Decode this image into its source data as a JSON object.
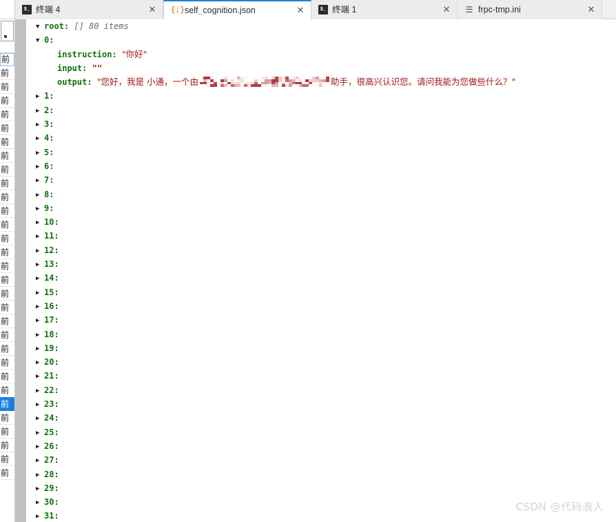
{
  "tabs": [
    {
      "label": "终端 4",
      "icon": "terminal-icon",
      "icon_glyph": "$_",
      "active": false,
      "close": "✕"
    },
    {
      "label": "self_cognition.json",
      "icon": "json-icon",
      "icon_glyph": "{;}",
      "active": true,
      "close": "✕"
    },
    {
      "label": "终端 1",
      "icon": "terminal-icon",
      "icon_glyph": "$_",
      "active": false,
      "close": "✕"
    },
    {
      "label": "frpc-tmp.ini",
      "icon": "ini-file-icon",
      "icon_glyph": "☰",
      "active": false,
      "close": "✕"
    }
  ],
  "sidebar": {
    "items": [
      {
        "label": "前",
        "selected": false,
        "boxed": true
      },
      {
        "label": "前",
        "selected": false,
        "boxed": false
      },
      {
        "label": "前",
        "selected": false,
        "boxed": false
      },
      {
        "label": "前",
        "selected": false,
        "boxed": false
      },
      {
        "label": "前",
        "selected": false,
        "boxed": false
      },
      {
        "label": "前",
        "selected": false,
        "boxed": false
      },
      {
        "label": "前",
        "selected": false,
        "boxed": false
      },
      {
        "label": "前",
        "selected": false,
        "boxed": false
      },
      {
        "label": "前",
        "selected": false,
        "boxed": false
      },
      {
        "label": "前",
        "selected": false,
        "boxed": false
      },
      {
        "label": "前",
        "selected": false,
        "boxed": false
      },
      {
        "label": "前",
        "selected": false,
        "boxed": false
      },
      {
        "label": "前",
        "selected": false,
        "boxed": false
      },
      {
        "label": "前",
        "selected": false,
        "boxed": false
      },
      {
        "label": "前",
        "selected": false,
        "boxed": false
      },
      {
        "label": "前",
        "selected": false,
        "boxed": false
      },
      {
        "label": "前",
        "selected": false,
        "boxed": false
      },
      {
        "label": "前",
        "selected": false,
        "boxed": false
      },
      {
        "label": "前",
        "selected": false,
        "boxed": false
      },
      {
        "label": "前",
        "selected": false,
        "boxed": false
      },
      {
        "label": "前",
        "selected": false,
        "boxed": false
      },
      {
        "label": "前",
        "selected": false,
        "boxed": false
      },
      {
        "label": "前",
        "selected": false,
        "boxed": false
      },
      {
        "label": "前",
        "selected": false,
        "boxed": false
      },
      {
        "label": "前",
        "selected": false,
        "boxed": false
      },
      {
        "label": "前",
        "selected": true,
        "boxed": false
      },
      {
        "label": "前",
        "selected": false,
        "boxed": false
      },
      {
        "label": "前",
        "selected": false,
        "boxed": false
      },
      {
        "label": "前",
        "selected": false,
        "boxed": false
      },
      {
        "label": "前",
        "selected": false,
        "boxed": false
      },
      {
        "label": "前",
        "selected": false,
        "boxed": false
      }
    ]
  },
  "viewer": {
    "root": {
      "twisty": "▼",
      "key": "root:",
      "type": "[]",
      "count": "80 items"
    },
    "expanded_item": {
      "twisty": "▼",
      "index": "0:",
      "fields": [
        {
          "key": "instruction:",
          "value": "\"你好\"",
          "redacted": false
        },
        {
          "key": "input:",
          "value": "\"\"",
          "redacted": false
        },
        {
          "key": "output:",
          "value_prefix": "\"您好，我是 小通，一个由",
          "value_suffix": "助手，很高兴认识您。请问我能为您做些什么？\"",
          "redacted": true
        }
      ]
    },
    "collapsed_items": [
      {
        "twisty": "▶",
        "index": "1:"
      },
      {
        "twisty": "▶",
        "index": "2:"
      },
      {
        "twisty": "▶",
        "index": "3:"
      },
      {
        "twisty": "▶",
        "index": "4:"
      },
      {
        "twisty": "▶",
        "index": "5:"
      },
      {
        "twisty": "▶",
        "index": "6:"
      },
      {
        "twisty": "▶",
        "index": "7:"
      },
      {
        "twisty": "▶",
        "index": "8:"
      },
      {
        "twisty": "▶",
        "index": "9:"
      },
      {
        "twisty": "▶",
        "index": "10:"
      },
      {
        "twisty": "▶",
        "index": "11:"
      },
      {
        "twisty": "▶",
        "index": "12:"
      },
      {
        "twisty": "▶",
        "index": "13:"
      },
      {
        "twisty": "▶",
        "index": "14:"
      },
      {
        "twisty": "▶",
        "index": "15:"
      },
      {
        "twisty": "▶",
        "index": "16:"
      },
      {
        "twisty": "▶",
        "index": "17:"
      },
      {
        "twisty": "▶",
        "index": "18:"
      },
      {
        "twisty": "▶",
        "index": "19:"
      },
      {
        "twisty": "▶",
        "index": "20:"
      },
      {
        "twisty": "▶",
        "index": "21:"
      },
      {
        "twisty": "▶",
        "index": "22:"
      },
      {
        "twisty": "▶",
        "index": "23:"
      },
      {
        "twisty": "▶",
        "index": "24:"
      },
      {
        "twisty": "▶",
        "index": "25:"
      },
      {
        "twisty": "▶",
        "index": "26:"
      },
      {
        "twisty": "▶",
        "index": "27:"
      },
      {
        "twisty": "▶",
        "index": "28:"
      },
      {
        "twisty": "▶",
        "index": "29:"
      },
      {
        "twisty": "▶",
        "index": "30:"
      },
      {
        "twisty": "▶",
        "index": "31:"
      }
    ]
  },
  "watermark": "CSDN @代码浪人",
  "colors": {
    "key_green": "#107010",
    "string_red": "#a31515",
    "meta_gray": "#6a6a6a",
    "active_tab_accent": "#1f7fd0",
    "selection_blue": "#1a7fe0",
    "scroll_gray": "#c0c0c0"
  }
}
